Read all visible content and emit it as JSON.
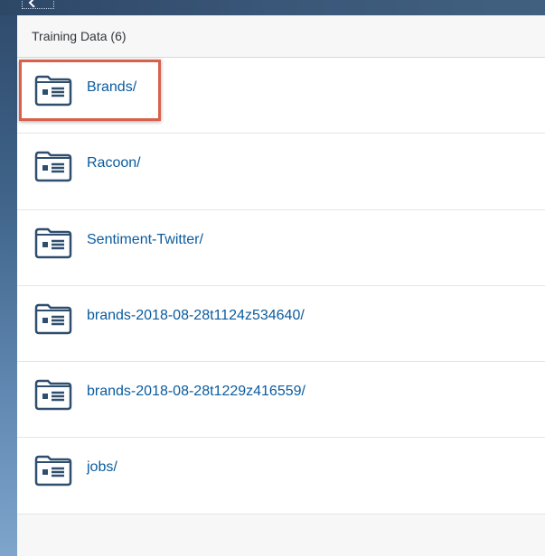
{
  "header": {
    "back_icon": "chevron-left-icon",
    "title": "Training Data (6)"
  },
  "list": {
    "item_icon": "folder-document-icon",
    "highlight_color": "#d8614e",
    "link_color": "#0a5b9e",
    "items": [
      {
        "label": "Brands/"
      },
      {
        "label": "Racoon/"
      },
      {
        "label": "Sentiment-Twitter/"
      },
      {
        "label": "brands-2018-08-28t1124z534640/"
      },
      {
        "label": "brands-2018-08-28t1229z416559/"
      },
      {
        "label": "jobs/"
      }
    ]
  }
}
